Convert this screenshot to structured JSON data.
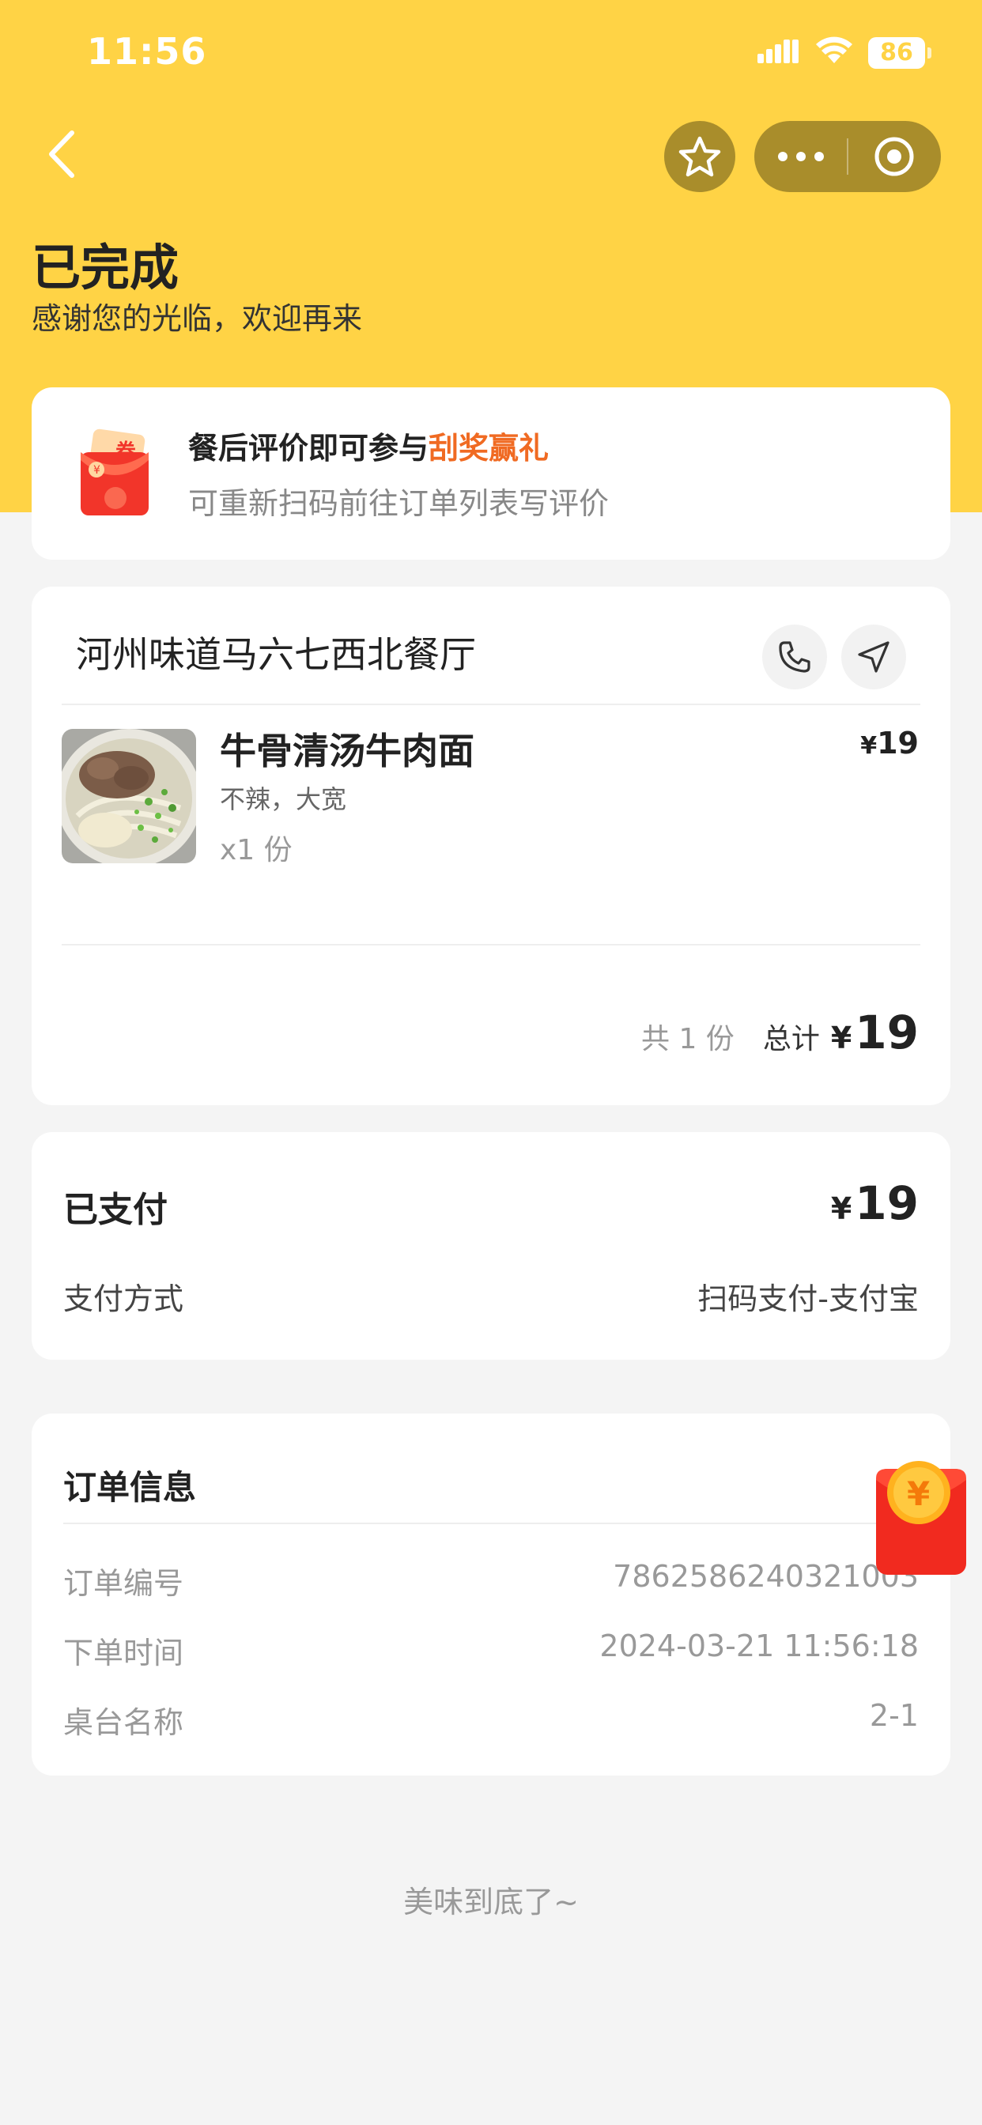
{
  "status_bar": {
    "time": "11:56",
    "battery": "86"
  },
  "nav": {
    "back_icon": "chevron-left-icon",
    "favorite_icon": "star-icon",
    "more_icon": "more-dots-icon",
    "close_icon": "target-circle-icon"
  },
  "header": {
    "title": "已完成",
    "subtitle": "感谢您的光临，欢迎再来"
  },
  "promo": {
    "title_prefix": "餐后评价即可参与",
    "title_highlight": "刮奖赢礼",
    "subtitle": "可重新扫码前往订单列表写评价",
    "icon_text": "券",
    "highlight_color": "#f06a22"
  },
  "order": {
    "store_name": "河州味道马六七西北餐厅",
    "phone_icon": "phone-icon",
    "nav_icon": "navigation-arrow-icon",
    "items": [
      {
        "name": "牛骨清汤牛肉面",
        "spec": "不辣，大宽",
        "qty": "x1 份",
        "currency": "¥",
        "price": "19"
      }
    ],
    "summary": {
      "count": "共 1 份",
      "total_label": "总计",
      "currency": "¥",
      "total": "19"
    }
  },
  "payment": {
    "status": "已支付",
    "currency": "¥",
    "amount": "19",
    "method_label": "支付方式",
    "method_value": "扫码支付-支付宝"
  },
  "info": {
    "title": "订单信息",
    "rows": [
      {
        "label": "订单编号",
        "value": "7862586240321003"
      },
      {
        "label": "下单时间",
        "value": "2024-03-21 11:56:18"
      },
      {
        "label": "桌台名称",
        "value": "2-1"
      }
    ]
  },
  "footer": {
    "text": "美味到底了~"
  },
  "floating": {
    "icon": "red-packet-icon",
    "symbol": "¥"
  },
  "colors": {
    "brand_yellow": "#ffd345",
    "capsule": "#a98d2b",
    "background": "#f4f4f4"
  }
}
